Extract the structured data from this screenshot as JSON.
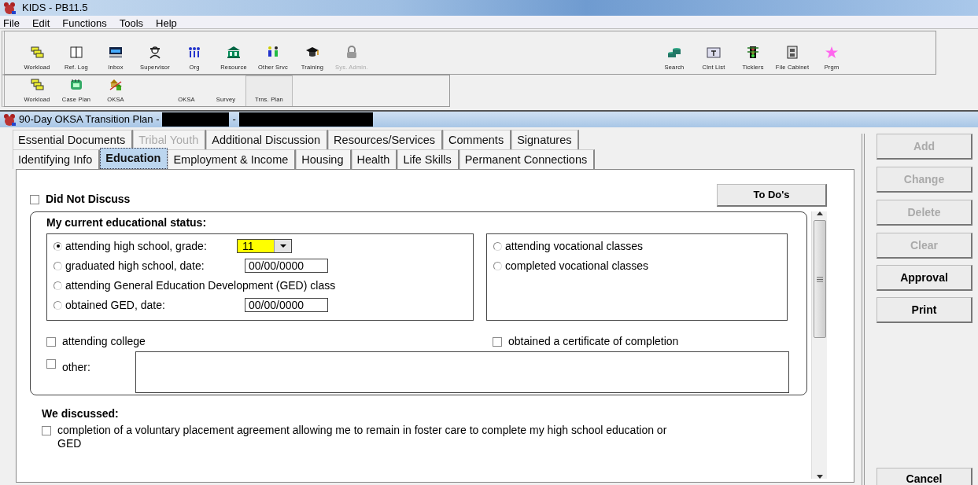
{
  "window": {
    "title": "KIDS - PB11.5"
  },
  "menu": [
    "File",
    "Edit",
    "Functions",
    "Tools",
    "Help"
  ],
  "toolbar_1": {
    "left": [
      {
        "label": "Workload",
        "disabled": false
      },
      {
        "label": "Ref. Log",
        "disabled": false
      },
      {
        "label": "Inbox",
        "disabled": false
      },
      {
        "label": "Supervisor",
        "disabled": false
      },
      {
        "label": "Org",
        "disabled": false
      },
      {
        "label": "Resource",
        "disabled": false
      },
      {
        "label": "Other Srvc",
        "disabled": false
      },
      {
        "label": "Training",
        "disabled": false
      },
      {
        "label": "Sys. Admin.",
        "disabled": true
      }
    ],
    "right": [
      {
        "label": "Search",
        "disabled": false
      },
      {
        "label": "Clnt List",
        "disabled": false
      },
      {
        "label": "Ticklers",
        "disabled": false
      },
      {
        "label": "File Cabinet",
        "disabled": false
      },
      {
        "label": "Prgm",
        "disabled": false
      }
    ]
  },
  "toolbar_2": {
    "left": [
      {
        "label": "Workload",
        "selected": false
      },
      {
        "label": "Case Plan",
        "selected": false
      },
      {
        "label": "OKSA",
        "selected": false
      }
    ],
    "right": [
      {
        "label": "OKSA",
        "selected": false
      },
      {
        "label": "Survey",
        "selected": false
      },
      {
        "label": "Trns. Plan",
        "selected": true
      }
    ]
  },
  "form": {
    "title": "90-Day OKSA Transition Plan -",
    "title_separator": "-",
    "tabs_row_1": [
      {
        "label": "Essential Documents",
        "selected": false,
        "disabled": false
      },
      {
        "label": "Tribal Youth",
        "selected": false,
        "disabled": true
      },
      {
        "label": "Additional Discussion",
        "selected": false,
        "disabled": false
      },
      {
        "label": "Resources/Services",
        "selected": false,
        "disabled": false
      },
      {
        "label": "Comments",
        "selected": false,
        "disabled": false
      },
      {
        "label": "Signatures",
        "selected": false,
        "disabled": false
      }
    ],
    "tabs_row_2": [
      {
        "label": "Identifying Info",
        "selected": false,
        "disabled": false
      },
      {
        "label": "Education",
        "selected": true,
        "disabled": false
      },
      {
        "label": "Employment & Income",
        "selected": false,
        "disabled": false
      },
      {
        "label": "Housing",
        "selected": false,
        "disabled": false
      },
      {
        "label": "Health",
        "selected": false,
        "disabled": false
      },
      {
        "label": "Life Skills",
        "selected": false,
        "disabled": false
      },
      {
        "label": "Permanent Connections",
        "selected": false,
        "disabled": false
      }
    ],
    "did_not_discuss": {
      "label": "Did Not Discuss",
      "checked": false
    },
    "todo_button": "To Do's",
    "status_group": {
      "title": "My current educational status:",
      "left_options": [
        {
          "label": "attending high school, grade:",
          "selected": true,
          "kind": "dropdown",
          "value": "11"
        },
        {
          "label": "graduated high school, date:",
          "selected": false,
          "kind": "date",
          "value": "00/00/0000"
        },
        {
          "label": "attending General Education Development (GED) class",
          "selected": false,
          "kind": "plain"
        },
        {
          "label": "obtained GED, date:",
          "selected": false,
          "kind": "date",
          "value": "00/00/0000"
        }
      ],
      "right_options": [
        {
          "label": "attending vocational classes",
          "selected": false
        },
        {
          "label": "completed vocational classes",
          "selected": false
        }
      ],
      "attending_college": {
        "label": "attending college",
        "checked": false
      },
      "certificate": {
        "label": "obtained a certificate of completion",
        "checked": false
      },
      "other": {
        "label": "other:",
        "checked": false
      }
    },
    "discussed": {
      "title": "We discussed:",
      "items": [
        {
          "label": "completion of a voluntary placement agreement allowing me to remain in foster care to complete my high school education or GED",
          "checked": false
        }
      ]
    }
  },
  "side_buttons": [
    {
      "label": "Add",
      "disabled": true
    },
    {
      "label": "Change",
      "disabled": true
    },
    {
      "label": "Delete",
      "disabled": true
    },
    {
      "label": "Clear",
      "disabled": true
    },
    {
      "label": "Approval",
      "disabled": false
    },
    {
      "label": "Print",
      "disabled": false
    }
  ],
  "cancel_button": "Cancel"
}
